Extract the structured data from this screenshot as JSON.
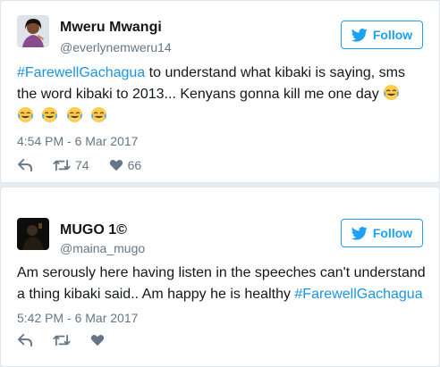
{
  "tweets": [
    {
      "name": "Mweru Mwangi",
      "handle": "@everlynemweru14",
      "follow_label": "Follow",
      "text_hashtag": "#FarewellGachagua",
      "text_line1_rest": " to understand what kibaki is saying, sms",
      "text_line2": "the word kibaki to 2013... Kenyans gonna kill me one day",
      "emoji": "face-with-tears-of-joy",
      "timestamp": "4:54 PM - 6 Mar 2017",
      "retweets": "74",
      "likes": "66"
    },
    {
      "name": "MUGO 1©",
      "handle": "@maina_mugo",
      "follow_label": "Follow",
      "text_line1": "Am serously here having listen in the speeches can't understand",
      "text_line2_start": "a thing kibaki said.. Am happy he is healthy ",
      "text_hashtag": "#FarewellGachagua",
      "timestamp": "5:42 PM - 6 Mar 2017"
    }
  ],
  "colors": {
    "accent": "#1da1f2",
    "hashtag": "#1b95e0",
    "muted": "#657786",
    "background": "#e6ecf0"
  },
  "icons": [
    "twitter-bird-icon",
    "reply-icon",
    "retweet-icon",
    "heart-icon"
  ]
}
